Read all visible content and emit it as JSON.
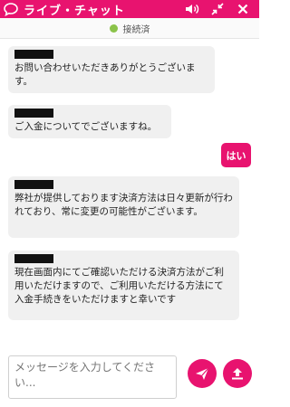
{
  "header": {
    "title": "ライブ・チャット",
    "icons": [
      "chat-bubble-icon",
      "speaker-icon",
      "collapse-icon",
      "close-icon"
    ],
    "color": "#e8136f"
  },
  "status": {
    "label": "接続済",
    "dot_color": "#8bc34a"
  },
  "messages": [
    {
      "side": "left",
      "text": "お問い合わせいただきありがとうございます。"
    },
    {
      "side": "left",
      "text": "ご入金についてでございますね。"
    },
    {
      "side": "right",
      "text": "はい"
    },
    {
      "side": "left",
      "text": "弊社が提供しております決済方法は日々更新が行われており、常に変更の可能性がございます。"
    },
    {
      "side": "left",
      "text": "現在画面内にてご確認いただける決済方法がご利用いただけますので、ご利用いただける方法にて入金手続きをいただけますと幸いです"
    }
  ],
  "composer": {
    "placeholder": "メッセージを入力してください...",
    "send_icon": "send-icon",
    "upload_icon": "upload-icon"
  }
}
